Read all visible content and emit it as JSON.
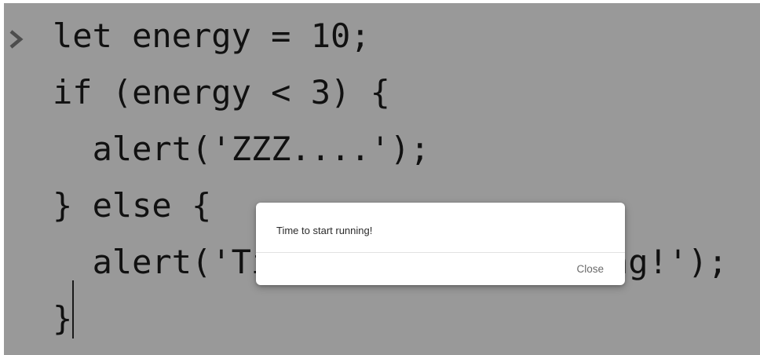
{
  "console": {
    "prompt_icon": "chevron-right-icon",
    "code_lines": [
      "let energy = 10;",
      "if (energy < 3) {",
      "  alert('ZZZ....');",
      "} else {",
      "  alert('Time to start running!');",
      "}"
    ]
  },
  "dialog": {
    "message": "Time to start running!",
    "close_label": "Close"
  },
  "colors": {
    "overlay": "#999999",
    "code_text": "#111111",
    "prompt_icon": "#4d4d4d",
    "dialog_bg": "#ffffff"
  }
}
